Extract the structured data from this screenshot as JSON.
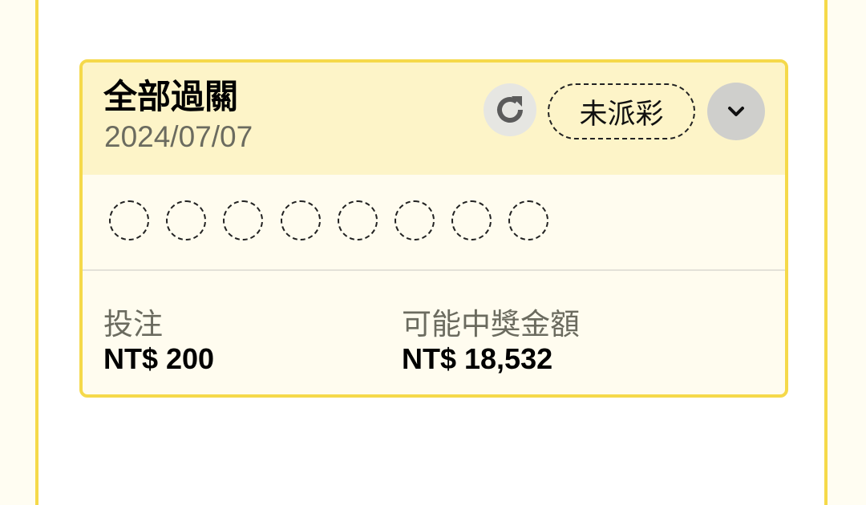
{
  "bet": {
    "title": "全部過關",
    "date": "2024/07/07",
    "status": "未派彩",
    "selection_slots": 8,
    "stake_label": "投注",
    "stake_value": "NT$ 200",
    "payout_label": "可能中獎金額",
    "payout_value": "NT$ 18,532"
  },
  "icons": {
    "refresh": "refresh-icon",
    "expand": "chevron-down-icon"
  },
  "colors": {
    "accent_border": "#f5d94a",
    "header_bg": "#fdf4c8",
    "card_bg": "#fffcef"
  }
}
